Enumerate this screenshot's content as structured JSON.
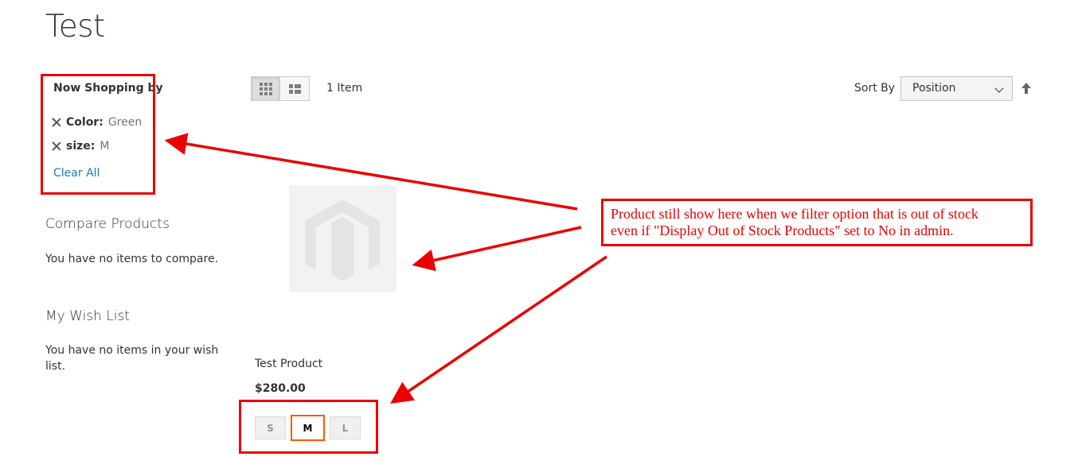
{
  "page": {
    "title": "Test"
  },
  "filters": {
    "title": "Now Shopping by",
    "items": [
      {
        "label": "Color:",
        "value": "Green"
      },
      {
        "label": "size:",
        "value": "M"
      }
    ],
    "clear_all": "Clear All"
  },
  "compare": {
    "title": "Compare Products",
    "empty_text": "You have no items to compare."
  },
  "wishlist": {
    "title": "My Wish List",
    "empty_line1": "You have no items in your wish",
    "empty_line2": "list."
  },
  "toolbar": {
    "modes": [
      {
        "name": "grid",
        "active": true
      },
      {
        "name": "list",
        "active": false
      }
    ],
    "amount": "1 Item",
    "sort_label": "Sort By",
    "sort_value": "Position"
  },
  "product": {
    "name": "Test Product",
    "price": "$280.00",
    "sizes": [
      {
        "label": "S",
        "selected": false
      },
      {
        "label": "M",
        "selected": true
      },
      {
        "label": "L",
        "selected": false
      }
    ]
  },
  "annotation": {
    "line1": "Product still show here when we filter option that is out of stock",
    "line2": "even if \"Display Out of Stock Products\" set to No in admin."
  },
  "colors": {
    "annotation_red": "#ea0000",
    "link_blue": "#1979c3",
    "swatch_selected": "#ff5501"
  },
  "icons": {
    "remove": "close-icon",
    "grid": "grid-icon",
    "list": "list-icon",
    "sort_direction": "arrow-up-icon",
    "placeholder": "magento-logo-icon"
  }
}
